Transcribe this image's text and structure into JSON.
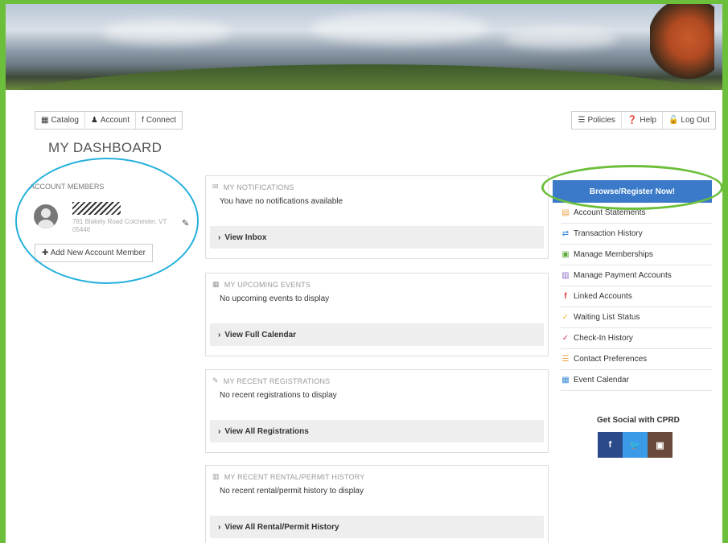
{
  "topnav": [
    {
      "icon": "grid-icon",
      "glyph": "▦",
      "label": "Catalog"
    },
    {
      "icon": "user-icon",
      "glyph": "♟",
      "label": "Account"
    },
    {
      "icon": "facebook-icon",
      "glyph": "f",
      "label": "Connect"
    }
  ],
  "rightnav": [
    {
      "icon": "policies-icon",
      "glyph": "☰",
      "label": "Policies"
    },
    {
      "icon": "help-icon",
      "glyph": "❓",
      "label": "Help"
    },
    {
      "icon": "logout-icon",
      "glyph": "🔓",
      "label": "Log Out"
    }
  ],
  "page_title": "MY DASHBOARD",
  "members": {
    "heading": "ACCOUNT MEMBERS",
    "address": "781 Blakely Road Colchester, VT 05446",
    "add_label": "Add New Account Member"
  },
  "panels": {
    "notifications": {
      "heading": "MY NOTIFICATIONS",
      "message": "You have no notifications available",
      "view": "View Inbox"
    },
    "events": {
      "heading": "MY UPCOMING EVENTS",
      "message": "No upcoming events to display",
      "view": "View Full Calendar"
    },
    "registrations": {
      "heading": "MY RECENT REGISTRATIONS",
      "message": "No recent registrations to display",
      "view": "View All Registrations"
    },
    "rentals": {
      "heading": "MY RECENT RENTAL/PERMIT HISTORY",
      "message": "No recent rental/permit history to display",
      "view": "View All Rental/Permit History"
    }
  },
  "browse_button": "Browse/Register Now!",
  "right_links": [
    {
      "icon": "statements-icon",
      "glyph": "▤",
      "color": "#e8a23a",
      "label": "Account Statements"
    },
    {
      "icon": "transactions-icon",
      "glyph": "⇄",
      "color": "#3a8ad8",
      "label": "Transaction History"
    },
    {
      "icon": "memberships-icon",
      "glyph": "▣",
      "color": "#5aaa3a",
      "label": "Manage Memberships"
    },
    {
      "icon": "payment-icon",
      "glyph": "▥",
      "color": "#8a6ac8",
      "label": "Manage Payment Accounts"
    },
    {
      "icon": "facebook-icon",
      "glyph": "f",
      "color": "#d83a3a",
      "label": "Linked Accounts"
    },
    {
      "icon": "check-icon",
      "glyph": "✓",
      "color": "#e8b83a",
      "label": "Waiting List Status"
    },
    {
      "icon": "checkin-icon",
      "glyph": "✓",
      "color": "#c83a5a",
      "label": "Check-In History"
    },
    {
      "icon": "contact-icon",
      "glyph": "☰",
      "color": "#e8a23a",
      "label": "Contact Preferences"
    },
    {
      "icon": "calendar-icon",
      "glyph": "▦",
      "color": "#3a8ad8",
      "label": "Event Calendar"
    }
  ],
  "social": {
    "title": "Get Social with CPRD",
    "buttons": [
      {
        "icon": "facebook-icon",
        "glyph": "f",
        "color": "#2a4a8a"
      },
      {
        "icon": "twitter-icon",
        "glyph": "🐦",
        "color": "#3a9ae8"
      },
      {
        "icon": "instagram-icon",
        "glyph": "▣",
        "color": "#6a4a3a"
      }
    ]
  }
}
